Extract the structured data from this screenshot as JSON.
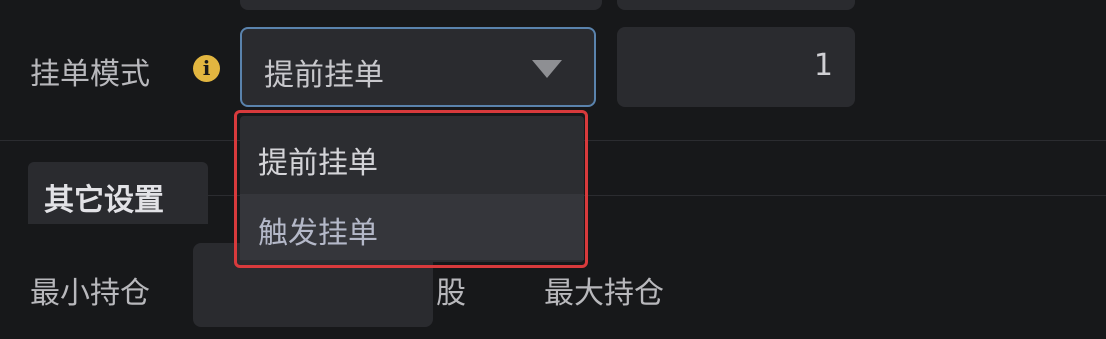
{
  "order_mode": {
    "label": "挂单模式",
    "info_icon": "info-icon",
    "selected": "提前挂单",
    "quantity": "1"
  },
  "dropdown": {
    "options": [
      {
        "label": "提前挂单"
      },
      {
        "label": "触发挂单"
      }
    ]
  },
  "other_settings": {
    "tab_label": "其它设置"
  },
  "position": {
    "min_label": "最小持仓",
    "min_value": "",
    "unit": "股",
    "max_label": "最大持仓"
  },
  "colors": {
    "background": "#17181a",
    "field": "#2a2b2f",
    "focus_border": "#5a83ad",
    "highlight_box": "#d83a3c",
    "info_icon": "#e2b640"
  }
}
